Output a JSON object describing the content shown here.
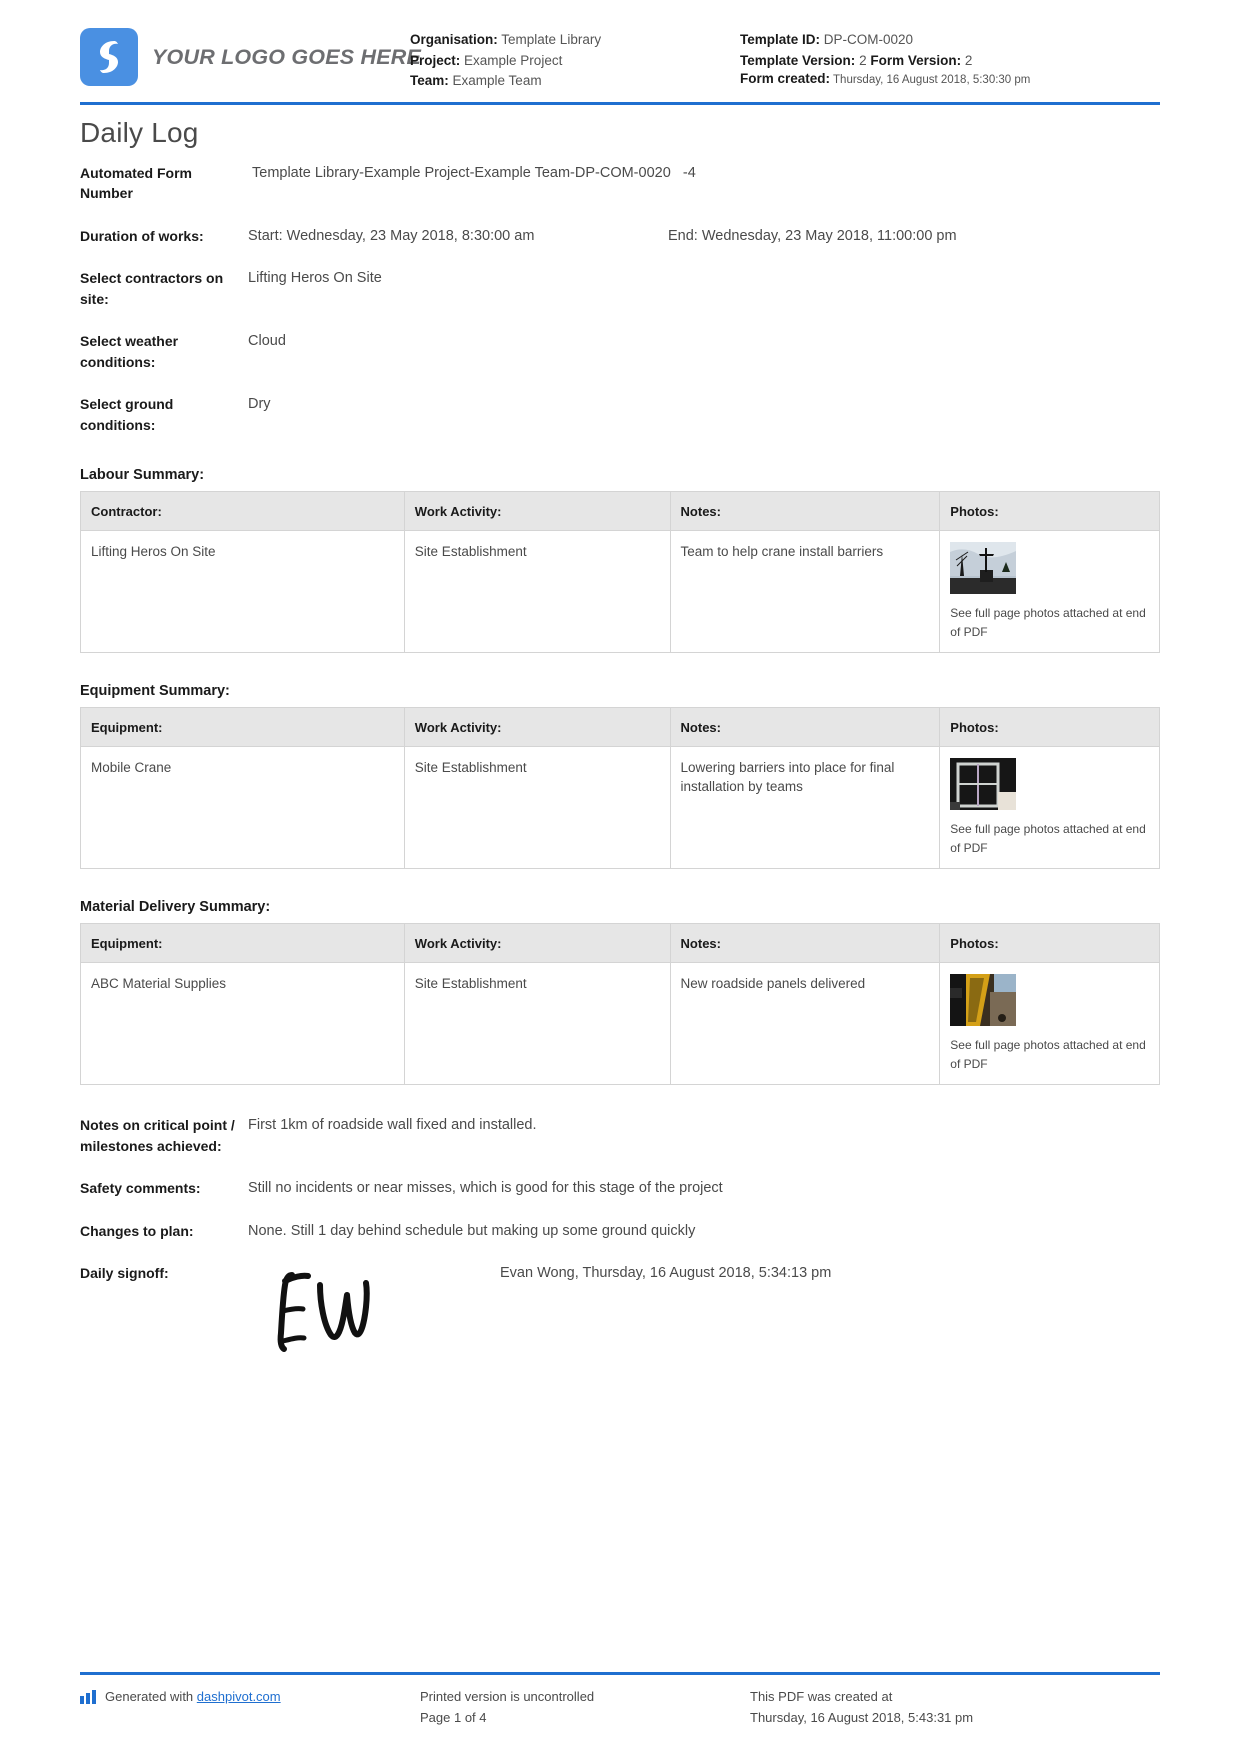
{
  "header": {
    "logo_text": "YOUR LOGO GOES HERE",
    "logo_color": "#4a90e2",
    "organisation_label": "Organisation:",
    "organisation_value": "Template Library",
    "project_label": "Project:",
    "project_value": "Example Project",
    "team_label": "Team:",
    "team_value": "Example Team",
    "template_id_label": "Template ID:",
    "template_id_value": "DP-COM-0020",
    "template_version_label": "Template Version:",
    "template_version_value": "2",
    "form_version_label": "Form Version:",
    "form_version_value": "2",
    "form_created_label": "Form created:",
    "form_created_value": "Thursday, 16 August 2018, 5:30:30 pm"
  },
  "title": "Daily Log",
  "fields": {
    "form_number_label": "Automated Form Number",
    "form_number_value": "Template Library-Example Project-Example Team-DP-COM-0020",
    "form_number_suffix": "-4",
    "duration_label": "Duration of works:",
    "duration_start": "Start: Wednesday, 23 May 2018, 8:30:00 am",
    "duration_end": "End: Wednesday, 23 May 2018, 11:00:00 pm",
    "contractors_label": "Select contractors on site:",
    "contractors_value": "Lifting Heros On Site",
    "weather_label": "Select weather conditions:",
    "weather_value": "Cloud",
    "ground_label": "Select ground conditions:",
    "ground_value": "Dry"
  },
  "photo_caption": "See full page photos attached at end of PDF",
  "labour_summary": {
    "title": "Labour Summary:",
    "columns": [
      "Contractor:",
      "Work Activity:",
      "Notes:",
      "Photos:"
    ],
    "rows": [
      {
        "contractor": "Lifting Heros On Site",
        "activity": "Site Establishment",
        "notes": "Team to help crane install barriers",
        "photo_name": "crane-on-site-photo"
      }
    ]
  },
  "equipment_summary": {
    "title": "Equipment Summary:",
    "columns": [
      "Equipment:",
      "Work Activity:",
      "Notes:",
      "Photos:"
    ],
    "rows": [
      {
        "equipment": "Mobile Crane",
        "activity": "Site Establishment",
        "notes": "Lowering barriers into place for final installation by teams",
        "photo_name": "barrier-panels-photo"
      }
    ]
  },
  "material_summary": {
    "title": "Material Delivery Summary:",
    "columns": [
      "Equipment:",
      "Work Activity:",
      "Notes:",
      "Photos:"
    ],
    "rows": [
      {
        "equipment": "ABC Material Supplies",
        "activity": "Site Establishment",
        "notes": "New roadside panels delivered",
        "photo_name": "roadside-panels-photo"
      }
    ]
  },
  "notes_section": {
    "milestones_label": "Notes on critical point / milestones achieved:",
    "milestones_value": "First 1km of roadside wall fixed and installed.",
    "safety_label": "Safety comments:",
    "safety_value": "Still no incidents or near misses, which is good for this stage of the project",
    "changes_label": "Changes to plan:",
    "changes_value": "None. Still 1 day behind schedule but making up some ground quickly"
  },
  "signoff": {
    "label": "Daily signoff:",
    "signature_initials": "EW",
    "name_and_time": "Evan Wong, Thursday, 16 August 2018, 5:34:13 pm"
  },
  "footer": {
    "generated_prefix": "Generated with",
    "generated_link": "dashpivot.com",
    "uncontrolled": "Printed version is uncontrolled",
    "page": "Page 1 of 4",
    "created_at_label": "This PDF was created at",
    "created_at_value": "Thursday, 16 August 2018, 5:43:31 pm"
  }
}
